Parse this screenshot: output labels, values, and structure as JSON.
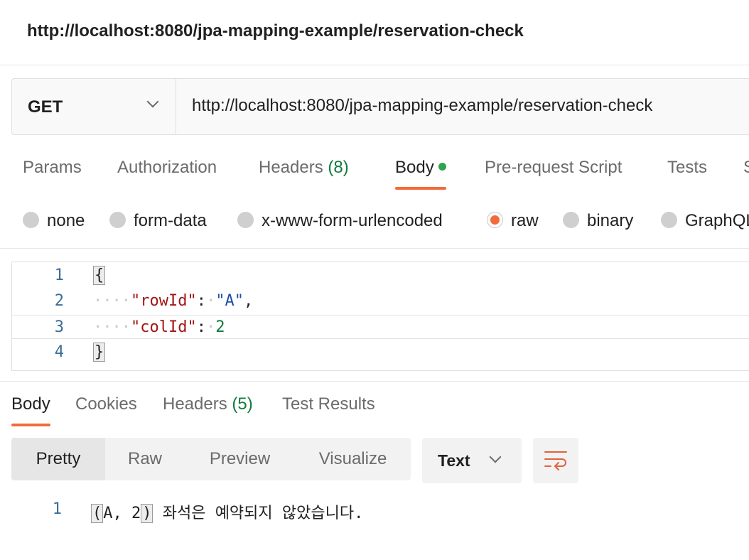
{
  "title": "http://localhost:8080/jpa-mapping-example/reservation-check",
  "request": {
    "method": "GET",
    "url": "http://localhost:8080/jpa-mapping-example/reservation-check"
  },
  "request_tabs": {
    "params": "Params",
    "authorization": "Authorization",
    "headers": "Headers",
    "headers_count": "(8)",
    "body": "Body",
    "prerequest": "Pre-request Script",
    "tests": "Tests",
    "settings": "S"
  },
  "body_types": {
    "none": "none",
    "form_data": "form-data",
    "urlencoded": "x-www-form-urlencoded",
    "raw": "raw",
    "binary": "binary",
    "graphql": "GraphQL",
    "selected": "raw"
  },
  "editor": {
    "line_numbers": [
      "1",
      "2",
      "3",
      "4"
    ],
    "open_brace": "{",
    "close_brace": "}",
    "key1": "\"rowId\"",
    "val1": "\"A\"",
    "key2": "\"colId\"",
    "val2": "2"
  },
  "response_tabs": {
    "body": "Body",
    "cookies": "Cookies",
    "headers": "Headers",
    "headers_count": "(5)",
    "test_results": "Test Results"
  },
  "response_view": {
    "pretty": "Pretty",
    "raw": "Raw",
    "preview": "Preview",
    "visualize": "Visualize",
    "format": "Text"
  },
  "response_body": {
    "line_number": "1",
    "open_paren": "(",
    "middle": "A, 2",
    "close_paren": ")",
    "message": " 좌석은 예약되지 않았습니다."
  },
  "colors": {
    "accent": "#f26b3a",
    "count_green": "#0f7b3d",
    "dot_green": "#2fa44f"
  }
}
